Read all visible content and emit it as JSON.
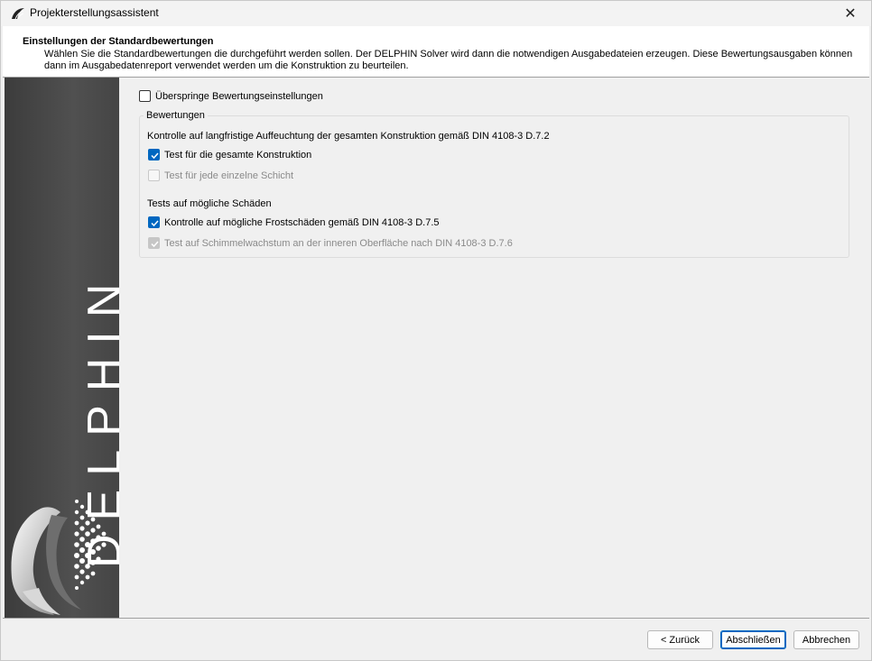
{
  "window": {
    "title": "Projekterstellungsassistent",
    "close_glyph": "✕"
  },
  "header": {
    "title": "Einstellungen der Standardbewertungen",
    "description": "Wählen Sie die Standardbewertungen die durchgeführt werden sollen. Der DELPHIN Solver wird dann die notwendigen Ausgabedateien erzeugen. Diese Bewertungsausgaben können dann im Ausgabedatenreport verwendet werden um die Konstruktion zu beurteilen."
  },
  "banner": {
    "word": "DELPHIN"
  },
  "content": {
    "skip": {
      "label": "Überspringe Bewertungseinstellungen",
      "checked": false
    },
    "group_title": "Bewertungen",
    "section1_title": "Kontrolle auf langfristige Auffeuchtung der gesamten Konstruktion gemäß DIN 4108-3 D.7.2",
    "section1_items": [
      {
        "label": "Test für die gesamte Konstruktion",
        "checked": true,
        "enabled": true
      },
      {
        "label": "Test für jede einzelne Schicht",
        "checked": false,
        "enabled": false
      }
    ],
    "section2_title": "Tests auf mögliche Schäden",
    "section2_items": [
      {
        "label": "Kontrolle auf mögliche Frostschäden gemäß DIN 4108-3 D.7.5",
        "checked": true,
        "enabled": true
      },
      {
        "label": "Test auf Schimmelwachstum an der inneren Oberfläche nach DIN 4108-3 D.7.6",
        "checked": true,
        "enabled": false
      }
    ]
  },
  "footer": {
    "back_label": "< Zurück",
    "finish_label": "Abschließen",
    "cancel_label": "Abbrechen"
  },
  "colors": {
    "accent": "#0067c0",
    "banner_bg": "#4a4a4a",
    "disabled_text": "#8a8a8a"
  },
  "icons": {
    "app": "delphin-app-icon",
    "close": "close-icon",
    "check": "checkmark-icon",
    "logo": "delphin-dolphin-logo"
  }
}
